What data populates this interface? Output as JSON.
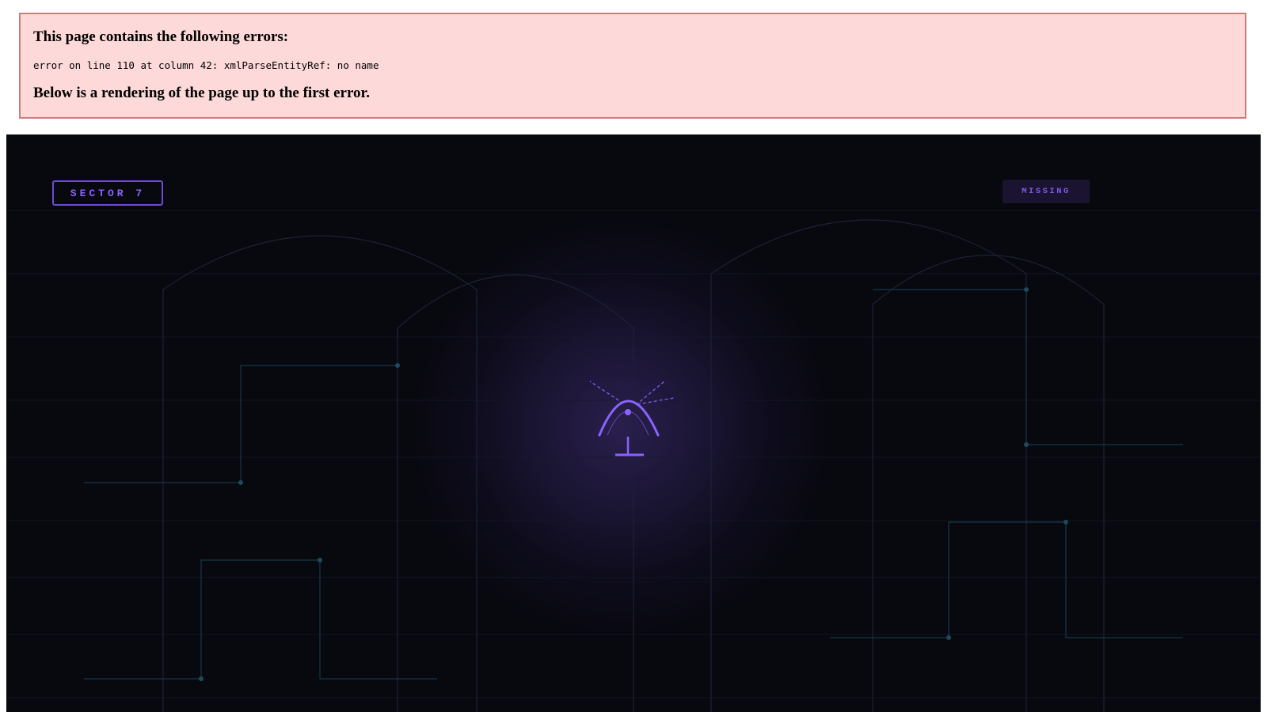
{
  "error_banner": {
    "heading": "This page contains the following errors:",
    "detail": "error on line 110 at column 42: xmlParseEntityRef: no name",
    "footer": "Below is a rendering of the page up to the first error."
  },
  "stage": {
    "sector_label": "SECTOR 7",
    "status_label": "MISSING",
    "center_icon": "antenna-signal-icon"
  },
  "colors": {
    "error_bg": "#fddad9",
    "error_border": "#d07a79",
    "stage_bg": "#07070d",
    "accent_purple": "#8a63ff",
    "circuit_line": "#1a3a4a"
  }
}
